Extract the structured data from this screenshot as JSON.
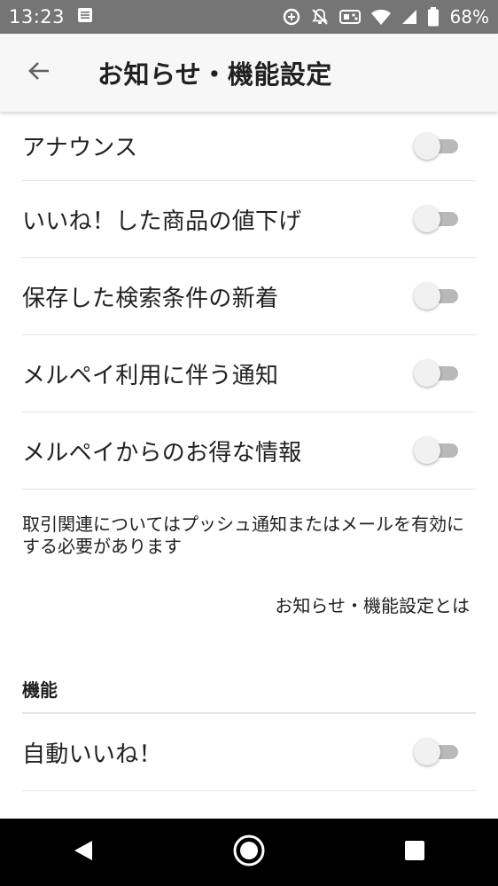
{
  "status_bar": {
    "time": "13:23",
    "battery_percent": "68%",
    "icons": [
      "notes-icon",
      "data-saver-icon",
      "notifications-off-icon",
      "game-controller-icon",
      "wifi-icon",
      "cellular-signal-icon",
      "battery-icon"
    ]
  },
  "app_bar": {
    "title": "お知らせ・機能設定",
    "back_icon": "arrow-left-icon"
  },
  "notification_settings": [
    {
      "label": "アナウンス",
      "enabled": false
    },
    {
      "label": "いいね！した商品の値下げ",
      "enabled": false
    },
    {
      "label": "保存した検索条件の新着",
      "enabled": false
    },
    {
      "label": "メルペイ利用に伴う通知",
      "enabled": false
    },
    {
      "label": "メルペイからのお得な情報",
      "enabled": false
    }
  ],
  "note": "取引関連についてはプッシュ通知またはメールを有効にする必要があります",
  "about_link": "お知らせ・機能設定とは",
  "features_section": {
    "header": "機能",
    "items": [
      {
        "label": "自動いいね！",
        "enabled": false
      }
    ]
  },
  "colors": {
    "status_bar": "#757575",
    "app_bar": "#f7f7f7",
    "toggle_track_off": "#b9b9b9",
    "toggle_thumb_off": "#f1f1f1",
    "divider": "#e6e6e6"
  },
  "nav_bar": {
    "icons": [
      "back-triangle-icon",
      "home-circle-icon",
      "recents-square-icon"
    ]
  }
}
